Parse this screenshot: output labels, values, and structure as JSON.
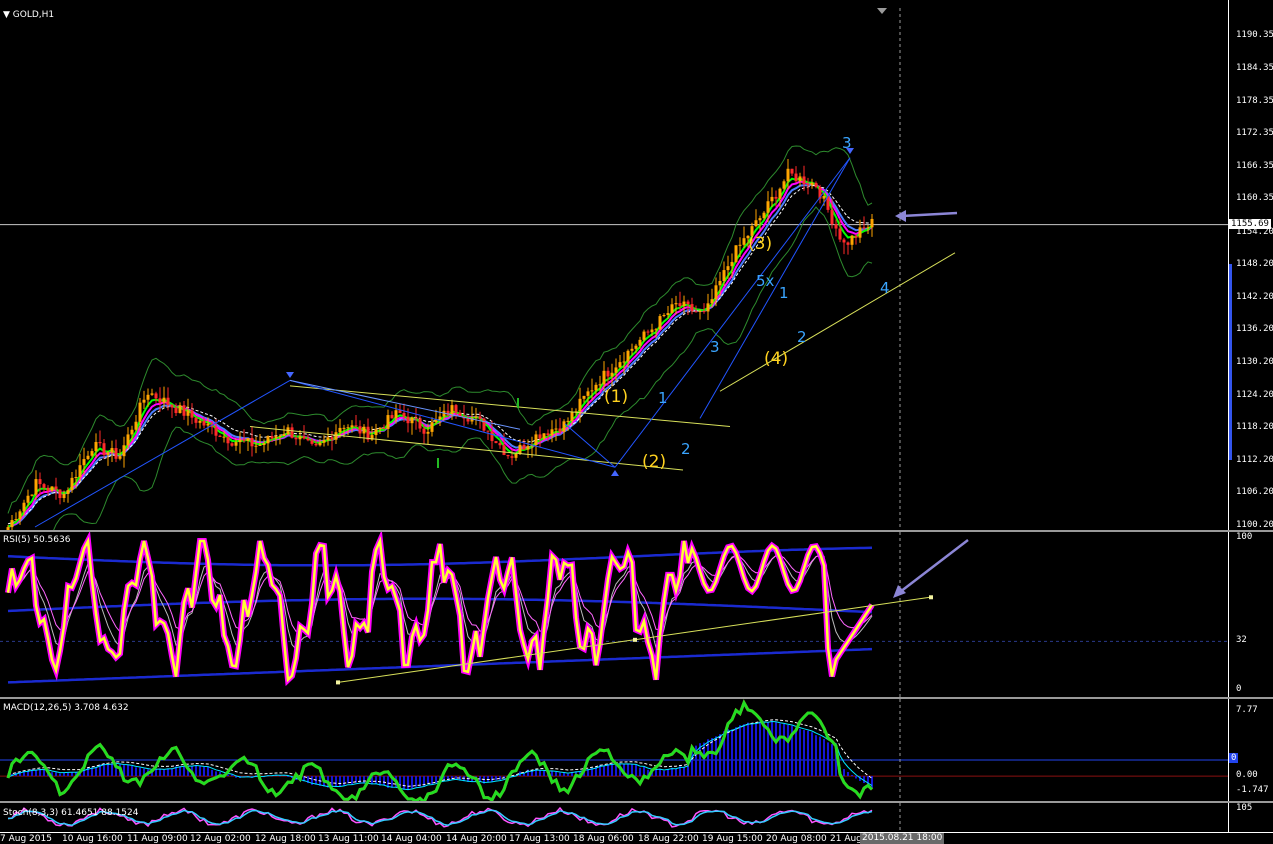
{
  "colors": {
    "bull": "#ffa500",
    "bear": "#ff2a2a",
    "ma_fast": "#00ff00",
    "ma_mid": "#ff00ff",
    "ma_slow": "#4a7dff",
    "bollinger": "#2d8a2d",
    "channel": "#d8e05a",
    "impulse": "#2255ff",
    "wave_yellow": "#ffd21f",
    "wave_cyan": "#3aa5ff",
    "arrow": "#8c86d6",
    "rsi": "#ffff33",
    "rsi_glow": "#ff00ff",
    "macd_hist": "#1616d8",
    "macd_line": "#22dd22"
  },
  "chart_data": [
    {
      "type": "candlestick",
      "title": "GOLD,H1",
      "ylim": [
        1100.0,
        1193.0
      ],
      "y_ticks": [
        "1190.35",
        "1184.35",
        "1178.35",
        "1172.35",
        "1166.35",
        "1160.35",
        "1154.20",
        "1148.20",
        "1142.20",
        "1136.20",
        "1130.20",
        "1124.20",
        "1118.20",
        "1112.20",
        "1106.20",
        "1100.20"
      ],
      "current_price": "1155.69",
      "anchors": [
        1100,
        1108,
        1106,
        1115,
        1113,
        1125,
        1122,
        1119,
        1116,
        1115,
        1118,
        1114,
        1119,
        1117,
        1121,
        1118,
        1122,
        1119,
        1113,
        1117,
        1119,
        1126,
        1131,
        1136,
        1141,
        1139,
        1150,
        1157,
        1165,
        1163,
        1152,
        1156
      ],
      "wave_labels": {
        "yellow": [
          "(1)",
          "(2)",
          "(3)",
          "(4)"
        ],
        "cyan": [
          "1",
          "2",
          "3",
          "1",
          "2",
          "3",
          "4"
        ],
        "cyan_5x": "5x"
      }
    },
    {
      "type": "line",
      "title": "RSI(5) 50.5636",
      "ylim": [
        0,
        100
      ],
      "y_ticks": [
        "100",
        "32",
        "0"
      ],
      "level": 32
    },
    {
      "type": "bar",
      "title": "MACD(12,26,5) 3.708 4.632",
      "ylim": [
        -2.5,
        8.5
      ],
      "y_ticks": [
        "7.77",
        "0.00",
        "-1.747"
      ],
      "marker": "0"
    },
    {
      "type": "line",
      "title": "Stoch(8,3,3) 61.4651 88.1524",
      "ylim": [
        0,
        110
      ],
      "y_ticks": [
        "105"
      ]
    }
  ],
  "x_axis": {
    "labels": [
      "7 Aug 2015",
      "10 Aug 16:00",
      "11 Aug 09:00",
      "12 Aug 02:00",
      "12 Aug 18:00",
      "13 Aug 11:00",
      "14 Aug 04:00",
      "14 Aug 20:00",
      "17 Aug 13:00",
      "18 Aug 06:00",
      "18 Aug 22:00",
      "19 Aug 15:00",
      "20 Aug 08:00",
      "21 Aug"
    ],
    "current": "2015.08.21 18:00"
  }
}
